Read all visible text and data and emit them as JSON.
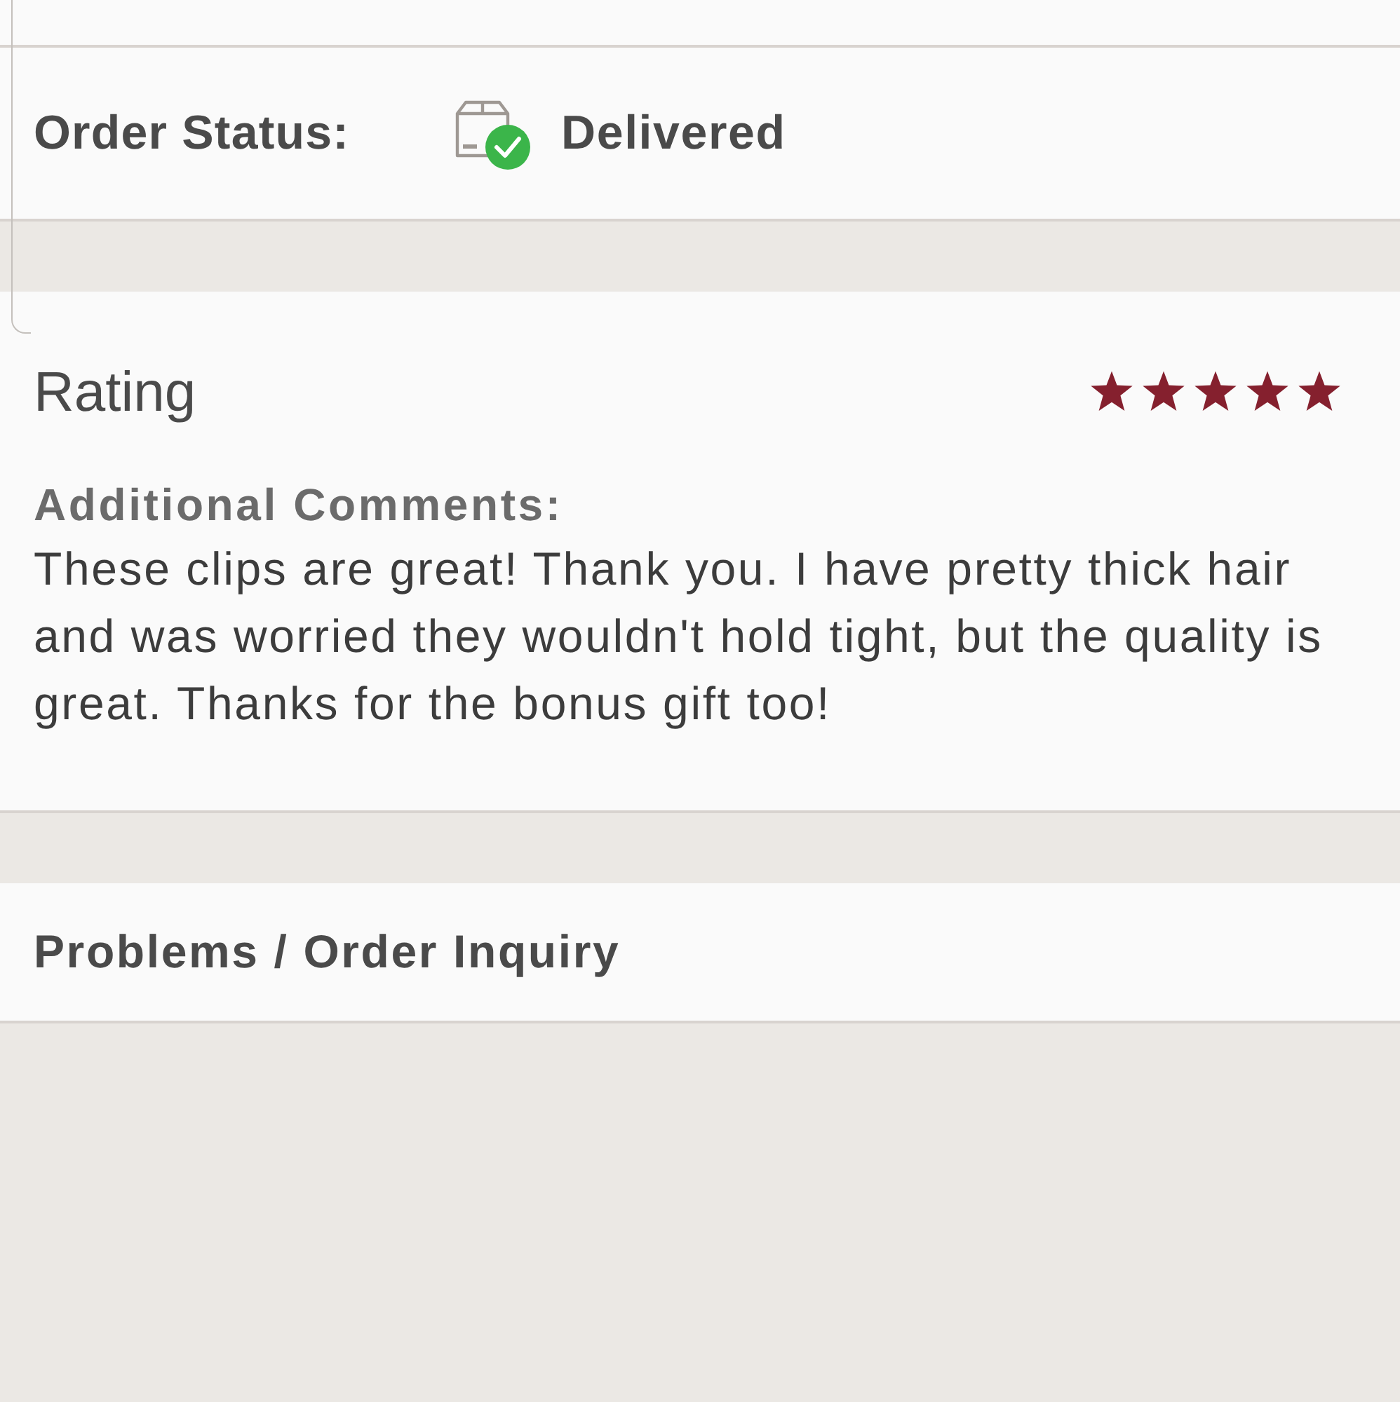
{
  "order_status": {
    "label": "Order Status:",
    "value": "Delivered"
  },
  "rating": {
    "title": "Rating",
    "stars": 5,
    "comments_label": "Additional Comments:",
    "comments": "These clips are great! Thank you. I have pretty thick hair and was worried they wouldn't hold tight, but the quality is great. Thanks for the bonus gift too!"
  },
  "inquiry": {
    "label": "Problems / Order Inquiry"
  }
}
